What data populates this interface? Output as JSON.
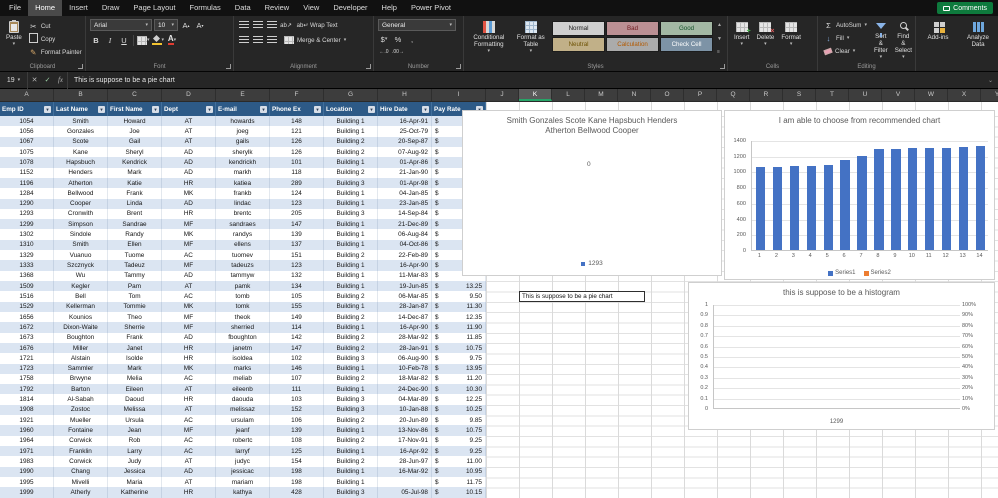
{
  "ribbon": {
    "tabs": [
      "File",
      "Home",
      "Insert",
      "Draw",
      "Page Layout",
      "Formulas",
      "Data",
      "Review",
      "View",
      "Developer",
      "Help",
      "Power Pivot"
    ],
    "active_tab": "Home",
    "comments_label": "Comments",
    "groups": {
      "clipboard": {
        "label": "Clipboard",
        "paste": "Paste",
        "cut": "Cut",
        "copy": "Copy",
        "format_painter": "Format Painter"
      },
      "font": {
        "label": "Font",
        "font_name": "Arial",
        "font_size": "10",
        "bold": "B",
        "italic": "I",
        "underline": "U"
      },
      "alignment": {
        "label": "Alignment",
        "wrap_text": "Wrap Text",
        "merge_center": "Merge & Center"
      },
      "number": {
        "label": "Number",
        "format": "General",
        "currency": "$",
        "percent": "%",
        "comma": ","
      },
      "styles": {
        "label": "Styles",
        "conditional_formatting": "Conditional Formatting",
        "format_as_table": "Format as Table",
        "gallery": [
          {
            "name": "Normal",
            "bg": "#cfcfcf",
            "fg": "#1a1a1a"
          },
          {
            "name": "Bad",
            "bg": "#bc9094",
            "fg": "#701a20"
          },
          {
            "name": "Good",
            "bg": "#a3b8a4",
            "fg": "#14522a"
          },
          {
            "name": "Neutral",
            "bg": "#c1b088",
            "fg": "#6e5305"
          },
          {
            "name": "Calculation",
            "bg": "#ababab",
            "fg": "#b35900"
          },
          {
            "name": "Check Cell",
            "bg": "#7d93a6",
            "fg": "#ffffff"
          }
        ]
      },
      "cells": {
        "label": "Cells",
        "insert": "Insert",
        "delete": "Delete",
        "format": "Format"
      },
      "editing": {
        "label": "Editing",
        "autosum": "AutoSum",
        "fill": "Fill",
        "clear": "Clear",
        "sort_filter": "Sort & Filter",
        "find_select": "Find & Select"
      },
      "addins": {
        "addins_label": "Add-ins",
        "analyze_label": "Analyze Data"
      }
    }
  },
  "formula_bar": {
    "name_box": "19",
    "formula": "This is suppose to be a pie chart"
  },
  "sheet": {
    "col_letters": [
      "A",
      "B",
      "C",
      "D",
      "E",
      "F",
      "G",
      "H",
      "I",
      "J",
      "K",
      "L",
      "M",
      "N",
      "O",
      "P",
      "Q",
      "R",
      "S",
      "T",
      "U",
      "V",
      "W",
      "X",
      "Y"
    ],
    "selected_col": "K",
    "selected_cell_text": "This is suppose to be a pie chart",
    "table": {
      "headers": [
        "Emp ID",
        "Last Name",
        "First Name",
        "Dept",
        "E-mail",
        "Phone Ex",
        "Location",
        "Hire Date",
        "Pay Rate"
      ],
      "rows": [
        [
          "1054",
          "Smith",
          "Howard",
          "AT",
          "howards",
          "148",
          "Building 1",
          "16-Apr-91",
          ""
        ],
        [
          "1056",
          "Gonzales",
          "Joe",
          "AT",
          "joeg",
          "121",
          "Building 1",
          "25-Oct-79",
          ""
        ],
        [
          "1067",
          "Scote",
          "Gail",
          "AT",
          "gails",
          "126",
          "Building 2",
          "20-Sep-87",
          ""
        ],
        [
          "1075",
          "Kane",
          "Sheryl",
          "AD",
          "sherylk",
          "126",
          "Building 2",
          "07-Aug-92",
          ""
        ],
        [
          "1078",
          "Hapsbuch",
          "Kendrick",
          "AD",
          "kendrickh",
          "101",
          "Building 1",
          "01-Apr-86",
          ""
        ],
        [
          "1152",
          "Henders",
          "Mark",
          "AD",
          "markh",
          "118",
          "Building 2",
          "21-Jan-90",
          ""
        ],
        [
          "1196",
          "Atherton",
          "Katie",
          "HR",
          "katiea",
          "289",
          "Building 3",
          "01-Apr-98",
          ""
        ],
        [
          "1284",
          "Bellwood",
          "Frank",
          "MK",
          "frankb",
          "124",
          "Building 1",
          "04-Jan-85",
          ""
        ],
        [
          "1290",
          "Cooper",
          "Linda",
          "AD",
          "lindac",
          "123",
          "Building 1",
          "23-Jan-85",
          ""
        ],
        [
          "1293",
          "Cronwith",
          "Brent",
          "HR",
          "brentc",
          "205",
          "Building 3",
          "14-Sep-84",
          ""
        ],
        [
          "1299",
          "Simpson",
          "Sandrae",
          "MF",
          "sandraes",
          "147",
          "Building 1",
          "21-Dec-89",
          ""
        ],
        [
          "1302",
          "Sindole",
          "Randy",
          "MK",
          "randys",
          "139",
          "Building 1",
          "06-Aug-84",
          ""
        ],
        [
          "1310",
          "Smith",
          "Ellen",
          "MF",
          "ellens",
          "137",
          "Building 1",
          "04-Oct-86",
          ""
        ],
        [
          "1329",
          "Vuanuo",
          "Tuome",
          "AC",
          "tuomev",
          "151",
          "Building 2",
          "22-Feb-89",
          ""
        ],
        [
          "1333",
          "Szcznyck",
          "Tadeuz",
          "MF",
          "tadeuzs",
          "123",
          "Building 1",
          "16-Apr-90",
          ""
        ],
        [
          "1368",
          "Wu",
          "Tammy",
          "AD",
          "tammyw",
          "132",
          "Building 1",
          "11-Mar-83",
          ""
        ],
        [
          "1509",
          "Kegler",
          "Pam",
          "AT",
          "pamk",
          "134",
          "Building 1",
          "19-Jun-85",
          "13.25"
        ],
        [
          "1516",
          "Bell",
          "Tom",
          "AC",
          "tomb",
          "105",
          "Building 2",
          "06-Mar-85",
          "9.50"
        ],
        [
          "1529",
          "Kellerman",
          "Tommie",
          "MK",
          "tomk",
          "155",
          "Building 1",
          "28-Jan-87",
          "11.30"
        ],
        [
          "1656",
          "Kounios",
          "Theo",
          "MF",
          "theok",
          "149",
          "Building 2",
          "14-Dec-87",
          "12.35"
        ],
        [
          "1672",
          "Dixon-Waite",
          "Sherrie",
          "MF",
          "sherried",
          "114",
          "Building 1",
          "16-Apr-90",
          "11.90"
        ],
        [
          "1673",
          "Boughton",
          "Frank",
          "AD",
          "fboughton",
          "142",
          "Building 2",
          "28-Mar-92",
          "11.85"
        ],
        [
          "1676",
          "Miller",
          "Janet",
          "HR",
          "janetm",
          "147",
          "Building 2",
          "28-Jan-91",
          "10.75"
        ],
        [
          "1721",
          "Alstain",
          "Isolde",
          "HR",
          "isoldea",
          "102",
          "Building 3",
          "06-Aug-90",
          "9.75"
        ],
        [
          "1723",
          "Sammler",
          "Mark",
          "MK",
          "marks",
          "146",
          "Building 1",
          "10-Feb-78",
          "13.95"
        ],
        [
          "1758",
          "Brwyne",
          "Melia",
          "AC",
          "meliab",
          "107",
          "Building 2",
          "18-Mar-82",
          "11.20"
        ],
        [
          "1792",
          "Barton",
          "Eileen",
          "AT",
          "eileenb",
          "111",
          "Building 1",
          "24-Dec-90",
          "10.30"
        ],
        [
          "1814",
          "Al-Sabah",
          "Daoud",
          "HR",
          "daouda",
          "103",
          "Building 3",
          "04-Mar-89",
          "12.25"
        ],
        [
          "1908",
          "Zostoc",
          "Melissa",
          "AT",
          "melissaz",
          "152",
          "Building 3",
          "10-Jan-88",
          "10.25"
        ],
        [
          "1921",
          "Mueller",
          "Ursula",
          "AC",
          "ursulam",
          "106",
          "Building 2",
          "20-Jun-89",
          "9.85"
        ],
        [
          "1960",
          "Fontaine",
          "Jean",
          "MF",
          "jeanf",
          "139",
          "Building 1",
          "13-Nov-86",
          "10.75"
        ],
        [
          "1964",
          "Corwick",
          "Rob",
          "AC",
          "robertc",
          "108",
          "Building 2",
          "17-Nov-91",
          "9.25"
        ],
        [
          "1971",
          "Franklin",
          "Larry",
          "AC",
          "larryf",
          "125",
          "Building 1",
          "16-Apr-92",
          "9.25"
        ],
        [
          "1983",
          "Corwick",
          "Judy",
          "AT",
          "judyc",
          "154",
          "Building 2",
          "28-Jun-97",
          "11.00"
        ],
        [
          "1990",
          "Chang",
          "Jessica",
          "AD",
          "jessicac",
          "198",
          "Building 1",
          "16-Mar-92",
          "10.95"
        ],
        [
          "1995",
          "Mivelli",
          "Maria",
          "AT",
          "mariam",
          "198",
          "Building 1",
          "",
          "11.75"
        ],
        [
          "1999",
          "Atherly",
          "Katherine",
          "HR",
          "kathya",
          "428",
          "Building 3",
          "05-Jul-98",
          "10.15"
        ]
      ]
    }
  },
  "chart_data": [
    {
      "type": "pie",
      "title": "Smith Gonzales Scote Kane Hapsbuch Henders Atherton Bellwood Cooper",
      "center_label": "0",
      "legend": [
        "1293"
      ],
      "legend_marker_color": "#4472c4"
    },
    {
      "type": "bar",
      "title": "I am able to choose from recommended chart",
      "categories": [
        1,
        2,
        3,
        4,
        5,
        6,
        7,
        8,
        9,
        10,
        11,
        12,
        13,
        14
      ],
      "series": [
        {
          "name": "Series1",
          "color": "#4472c4",
          "values": [
            1054,
            1056,
            1067,
            1075,
            1078,
            1152,
            1196,
            1284,
            1290,
            1293,
            1299,
            1302,
            1310,
            1329
          ]
        },
        {
          "name": "Series2",
          "color": "#ed7d31",
          "values": []
        }
      ],
      "ylim": [
        0,
        1400
      ],
      "y_ticks": [
        0,
        200,
        400,
        600,
        800,
        1000,
        1200,
        1400
      ],
      "legend_position": "bottom"
    },
    {
      "type": "histogram",
      "title": "this is suppose to be a histogram",
      "x_label": "1299",
      "y_left_ticks": [
        "1",
        "0.9",
        "0.8",
        "0.7",
        "0.6",
        "0.5",
        "0.4",
        "0.3",
        "0.2",
        "0.1",
        "0"
      ],
      "y_right_ticks": [
        "100%",
        "90%",
        "80%",
        "70%",
        "60%",
        "50%",
        "40%",
        "30%",
        "20%",
        "10%",
        "0%"
      ],
      "values": []
    }
  ]
}
